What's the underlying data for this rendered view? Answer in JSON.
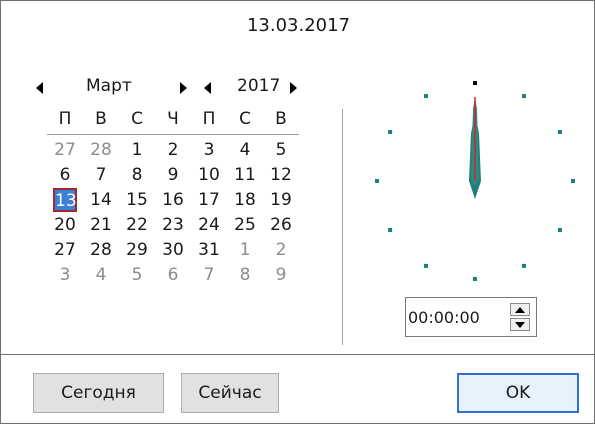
{
  "title_date": "13.03.2017",
  "nav": {
    "month": "Март",
    "year": "2017"
  },
  "weekdays": [
    "П",
    "В",
    "С",
    "Ч",
    "П",
    "С",
    "В"
  ],
  "weeks": [
    [
      {
        "d": "27",
        "o": true
      },
      {
        "d": "28",
        "o": true
      },
      {
        "d": "1"
      },
      {
        "d": "2"
      },
      {
        "d": "3"
      },
      {
        "d": "4"
      },
      {
        "d": "5"
      }
    ],
    [
      {
        "d": "6"
      },
      {
        "d": "7"
      },
      {
        "d": "8"
      },
      {
        "d": "9"
      },
      {
        "d": "10"
      },
      {
        "d": "11"
      },
      {
        "d": "12"
      }
    ],
    [
      {
        "d": "13",
        "s": true
      },
      {
        "d": "14"
      },
      {
        "d": "15"
      },
      {
        "d": "16"
      },
      {
        "d": "17"
      },
      {
        "d": "18"
      },
      {
        "d": "19"
      }
    ],
    [
      {
        "d": "20"
      },
      {
        "d": "21"
      },
      {
        "d": "22"
      },
      {
        "d": "23"
      },
      {
        "d": "24"
      },
      {
        "d": "25"
      },
      {
        "d": "26"
      }
    ],
    [
      {
        "d": "27"
      },
      {
        "d": "28"
      },
      {
        "d": "29"
      },
      {
        "d": "30"
      },
      {
        "d": "31"
      },
      {
        "d": "1",
        "o": true
      },
      {
        "d": "2",
        "o": true
      }
    ],
    [
      {
        "d": "3",
        "o": true
      },
      {
        "d": "4",
        "o": true
      },
      {
        "d": "5",
        "o": true
      },
      {
        "d": "6",
        "o": true
      },
      {
        "d": "7",
        "o": true
      },
      {
        "d": "8",
        "o": true
      },
      {
        "d": "9",
        "o": true
      }
    ]
  ],
  "time": {
    "value": "00:00:00"
  },
  "buttons": {
    "today": "Сегодня",
    "now": "Сейчас",
    "ok": "OK"
  },
  "colors": {
    "accent": "#3c7fd9",
    "clock_hand": "#1f7f7a",
    "second_hand": "#d92020",
    "marker": "#1f7f7a"
  }
}
